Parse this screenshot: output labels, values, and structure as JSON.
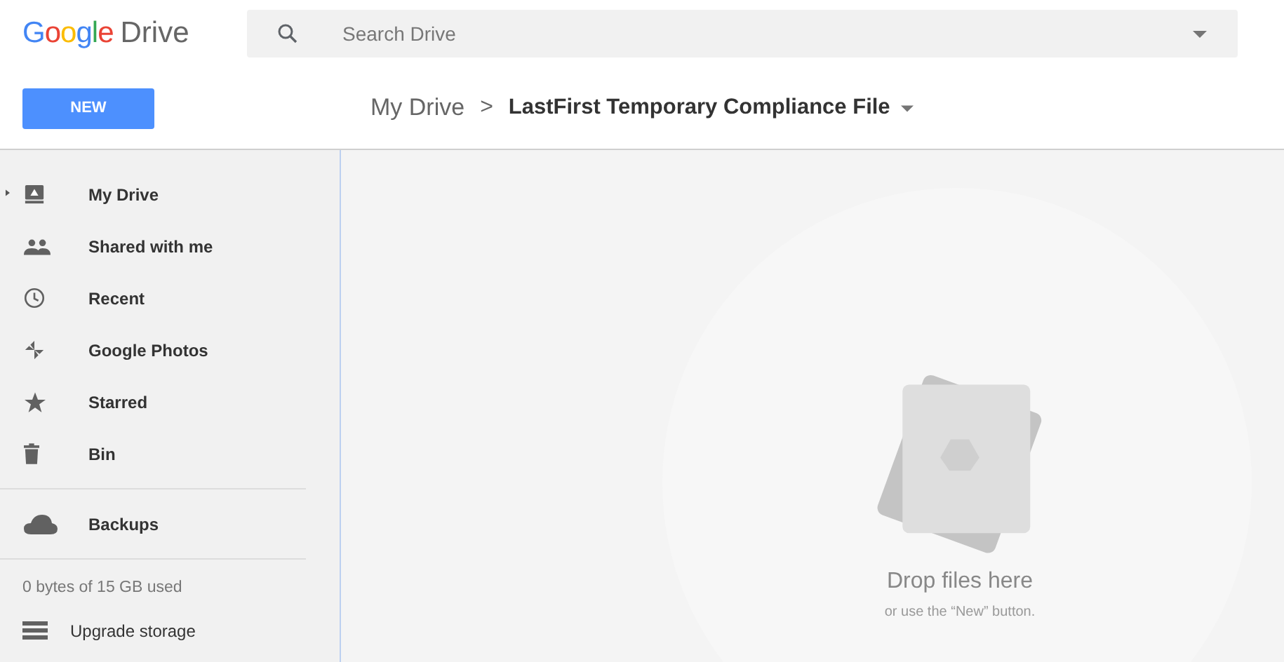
{
  "logo": {
    "brand": "Google",
    "product": "Drive"
  },
  "search": {
    "placeholder": "Search Drive"
  },
  "new_button": "NEW",
  "breadcrumb": {
    "root": "My Drive",
    "separator": ">",
    "current": "LastFirst Temporary Compliance File"
  },
  "sidebar": {
    "items": [
      {
        "label": "My Drive",
        "kind": "drive",
        "expandable": true
      },
      {
        "label": "Shared with me",
        "kind": "shared",
        "expandable": false
      },
      {
        "label": "Recent",
        "kind": "recent",
        "expandable": false
      },
      {
        "label": "Google Photos",
        "kind": "photos",
        "expandable": false
      },
      {
        "label": "Starred",
        "kind": "starred",
        "expandable": false
      },
      {
        "label": "Bin",
        "kind": "bin",
        "expandable": false
      }
    ],
    "secondary_items": [
      {
        "label": "Backups",
        "kind": "backups",
        "expandable": false
      }
    ],
    "storage": "0 bytes of 15 GB used",
    "upgrade": "Upgrade storage"
  },
  "empty_state": {
    "title": "Drop files here",
    "hint": "or use the “New” button."
  }
}
